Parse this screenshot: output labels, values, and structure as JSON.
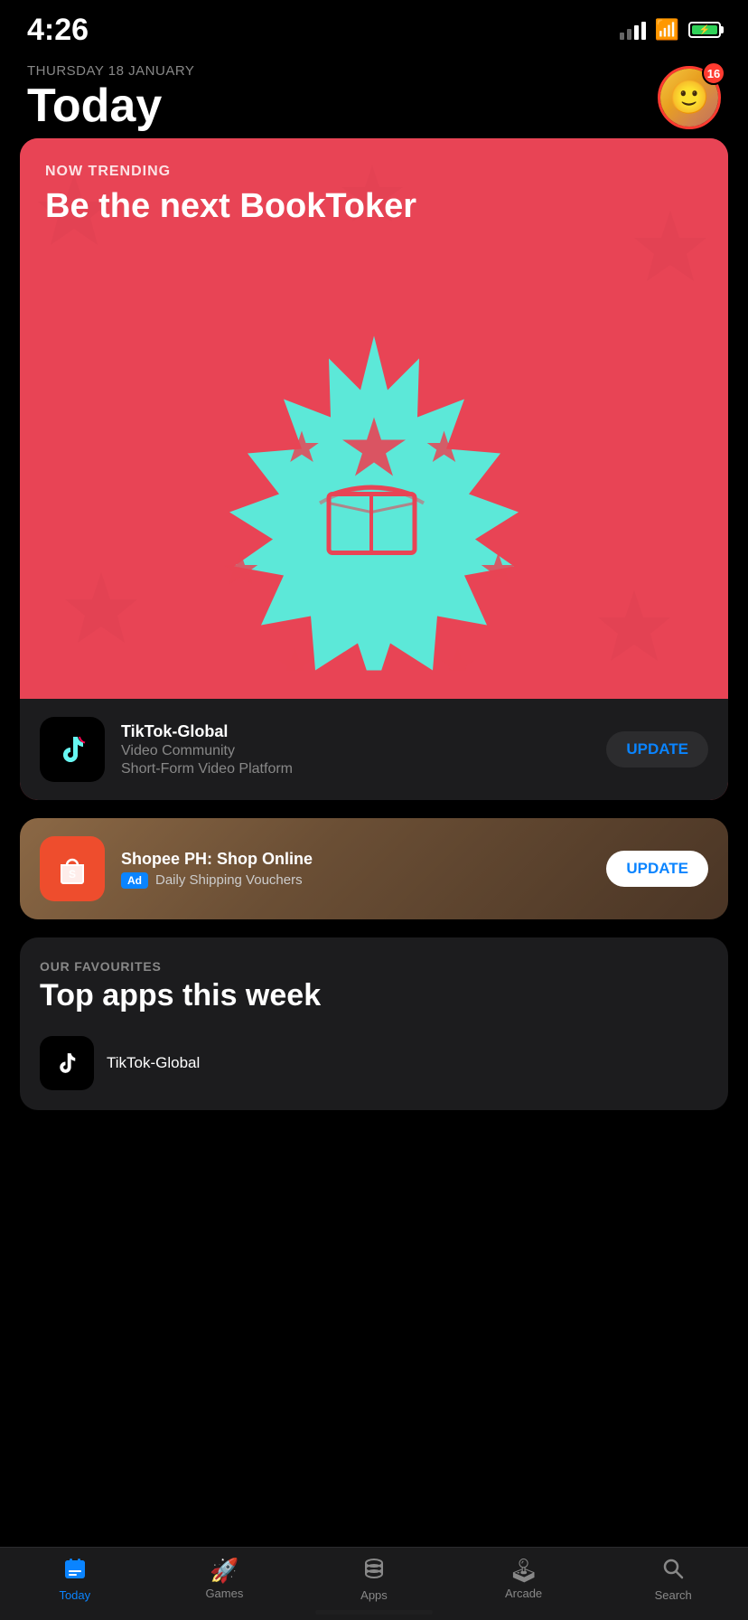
{
  "statusBar": {
    "time": "4:26",
    "battery": "⚡"
  },
  "header": {
    "date": "Thursday 18 January",
    "title": "Today",
    "profileBadge": "16"
  },
  "featuredCard": {
    "badge": "NOW TRENDING",
    "headline": "Be the next BookToker",
    "appName": "TikTok-Global",
    "appSubtitle1": "Video Community",
    "appSubtitle2": "Short-Form Video Platform",
    "updateLabel": "UPDATE"
  },
  "adCard": {
    "appName": "Shopee PH: Shop Online",
    "adLabel": "Ad",
    "subtitle": "Daily Shipping Vouchers",
    "updateLabel": "UPDATE"
  },
  "favouritesCard": {
    "badge": "OUR FAVOURITES",
    "title": "Top apps this week",
    "apps": [
      {
        "name": "TikTok-Global"
      }
    ]
  },
  "tabBar": {
    "tabs": [
      {
        "id": "today",
        "label": "Today",
        "icon": "📋",
        "active": true
      },
      {
        "id": "games",
        "label": "Games",
        "icon": "🚀",
        "active": false
      },
      {
        "id": "apps",
        "label": "Apps",
        "icon": "🗂",
        "active": false
      },
      {
        "id": "arcade",
        "label": "Arcade",
        "icon": "🕹",
        "active": false
      },
      {
        "id": "search",
        "label": "Search",
        "icon": "🔍",
        "active": false
      }
    ]
  }
}
